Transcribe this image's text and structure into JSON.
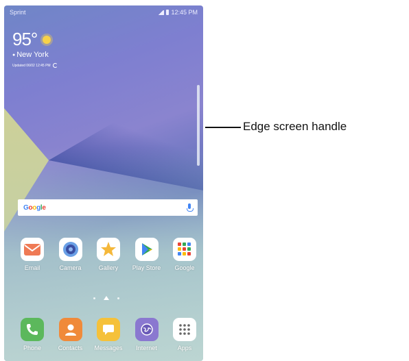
{
  "status_bar": {
    "carrier": "Sprint",
    "time": "12:45 PM"
  },
  "weather": {
    "temperature": "95°",
    "city": "New York",
    "updated": "Updated 06/02 12:45 PM"
  },
  "search_bar": {
    "logo": "Google"
  },
  "home_row": [
    {
      "label": "Email",
      "icon": "email-icon"
    },
    {
      "label": "Camera",
      "icon": "camera-icon"
    },
    {
      "label": "Gallery",
      "icon": "gallery-icon"
    },
    {
      "label": "Play Store",
      "icon": "play-store-icon"
    },
    {
      "label": "Google",
      "icon": "google-folder-icon"
    }
  ],
  "dock": [
    {
      "label": "Phone",
      "icon": "phone-icon"
    },
    {
      "label": "Contacts",
      "icon": "contacts-icon"
    },
    {
      "label": "Messages",
      "icon": "messages-icon"
    },
    {
      "label": "Internet",
      "icon": "internet-icon"
    },
    {
      "label": "Apps",
      "icon": "apps-grid-icon"
    }
  ],
  "callout": {
    "text": "Edge screen handle"
  }
}
